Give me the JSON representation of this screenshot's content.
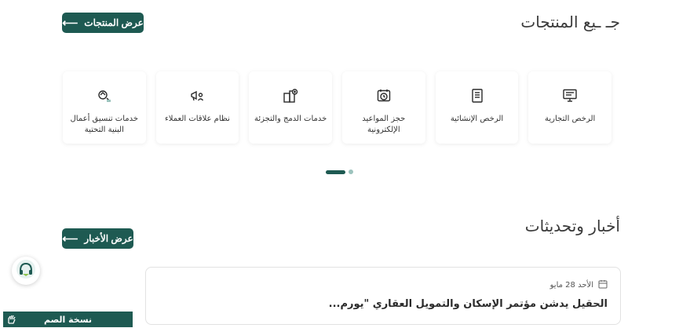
{
  "products": {
    "title": "جـ ـيع المنتجات",
    "all_button": "عرض المنتجات",
    "cards": [
      {
        "label": "الرخص التجارية",
        "icon": "monitor-document-icon"
      },
      {
        "label": "الرخص الإنشائية",
        "icon": "document-list-icon"
      },
      {
        "label": "حجز المواعيد الإلكترونية",
        "icon": "timer-calendar-icon"
      },
      {
        "label": "خدمات الدمج والتجزئة",
        "icon": "building-plus-icon"
      },
      {
        "label": "نظام علاقات العملاء",
        "icon": "megaphone-user-icon"
      },
      {
        "label": "خدمات تنسيق أعمال البنية التحتية",
        "icon": "infrastructure-icon"
      }
    ]
  },
  "news": {
    "title": "أخبار وتحديثات",
    "all_button": "عرض الأخبار",
    "items": [
      {
        "date": "الأحد 28 مايو",
        "headline": "الحقيل يدشن مؤتمر الإسكان والتمويل العقاري \"يورم..."
      }
    ]
  },
  "accessibility": {
    "label": "نسخة الصم"
  },
  "colors": {
    "primary": "#1e5a52",
    "accent": "#9cc3bd"
  }
}
